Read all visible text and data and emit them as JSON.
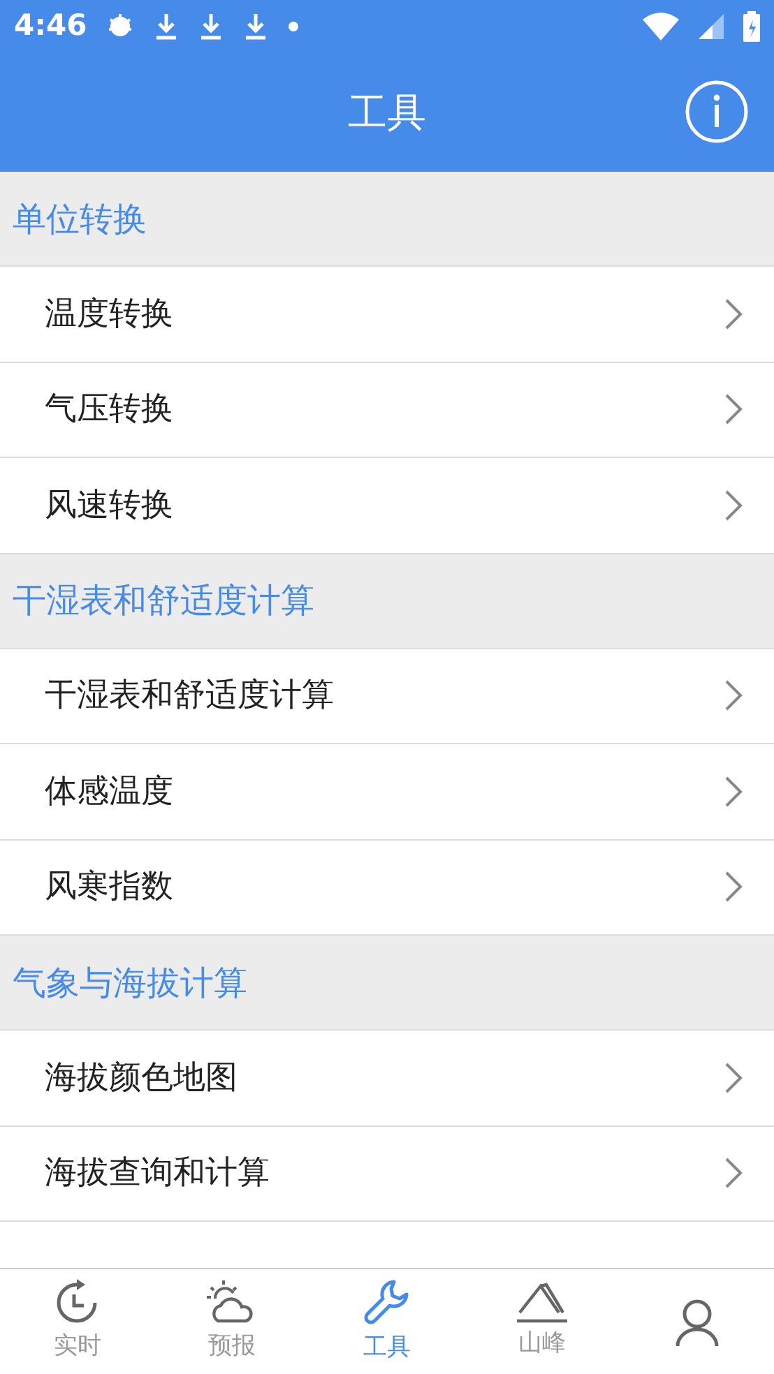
{
  "status_bar": {
    "time": "4:46"
  },
  "header": {
    "title": "工具"
  },
  "sections": [
    {
      "title": "单位转换",
      "items": [
        "温度转换",
        "气压转换",
        "风速转换"
      ]
    },
    {
      "title": "干湿表和舒适度计算",
      "items": [
        "干湿表和舒适度计算",
        "体感温度",
        "风寒指数"
      ]
    },
    {
      "title": "气象与海拔计算",
      "items": [
        "海拔颜色地图",
        "海拔查询和计算"
      ]
    }
  ],
  "tabs": [
    {
      "kind": "realtime",
      "label": "实时",
      "selected": false
    },
    {
      "kind": "forecast",
      "label": "预报",
      "selected": false
    },
    {
      "kind": "tools",
      "label": "工具",
      "selected": true
    },
    {
      "kind": "peak",
      "label": "山峰",
      "selected": false
    },
    {
      "kind": "user",
      "selected": false
    }
  ]
}
